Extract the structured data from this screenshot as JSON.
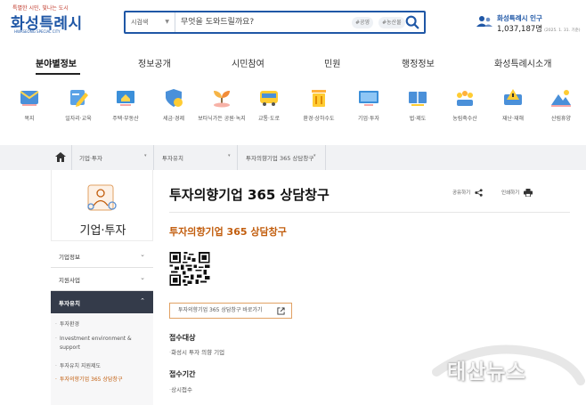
{
  "header": {
    "logo_slogan": "특별한 시민, 빛나는 도시",
    "logo_main": "화성특례시",
    "logo_sub": "HWASEONG SPECIAL CITY",
    "search": {
      "scope": "시검색",
      "placeholder": "무엇을 도와드릴까요?",
      "tags": [
        "#공영",
        "#농산물"
      ]
    },
    "population": {
      "label": "화성특례시 인구",
      "count": "1,037,187명",
      "date": "(2025. 1. 31. 기준)"
    }
  },
  "gnb": [
    "분야별정보",
    "정보공개",
    "시민참여",
    "민원",
    "행정정보",
    "화성특례시소개"
  ],
  "categories": [
    {
      "label": "복지",
      "icon": "mail-icon"
    },
    {
      "label": "일자리·교육",
      "icon": "pencil-icon"
    },
    {
      "label": "주택·부동산",
      "icon": "house-monitor-icon"
    },
    {
      "label": "세금·경제",
      "icon": "shield-coin-icon"
    },
    {
      "label": "보타닉가든 공원·녹지",
      "icon": "sprout-icon"
    },
    {
      "label": "교통·도로",
      "icon": "bus-icon"
    },
    {
      "label": "환경·상하수도",
      "icon": "trash-bin-icon"
    },
    {
      "label": "기업·투자",
      "icon": "monitor-icon"
    },
    {
      "label": "법·제도",
      "icon": "law-book-icon"
    },
    {
      "label": "농림축수산",
      "icon": "crops-icon"
    },
    {
      "label": "재난·재해",
      "icon": "warning-icon"
    },
    {
      "label": "산림휴양",
      "icon": "mountain-icon"
    }
  ],
  "breadcrumb": [
    "기업·투자",
    "투자유치",
    "투자의향기업 365 상담창구"
  ],
  "sidebar": {
    "title": "기업·투자",
    "menu": [
      "기업정보",
      "지원사업",
      "투자유치"
    ],
    "sub": [
      "투자환경",
      "Investment environment & support",
      "투자유치 지원제도",
      "투자의향기업 365 상담창구"
    ]
  },
  "main": {
    "title": "투자의향기업 365 상담창구",
    "share_label": "공유하기",
    "print_label": "인쇄하기",
    "subtitle": "투자의향기업 365 상담창구",
    "link_button": "투자의향기업 365 상담창구 바로가기",
    "sections": [
      {
        "head": "접수대상",
        "body": "화성시 투자 의향 기업"
      },
      {
        "head": "접수기간",
        "body": "상시접수"
      }
    ]
  },
  "watermark": "태산뉴스",
  "colors": {
    "brand_blue": "#1f57a6",
    "accent_orange": "#c25d0d",
    "side_active": "#343b4a"
  }
}
